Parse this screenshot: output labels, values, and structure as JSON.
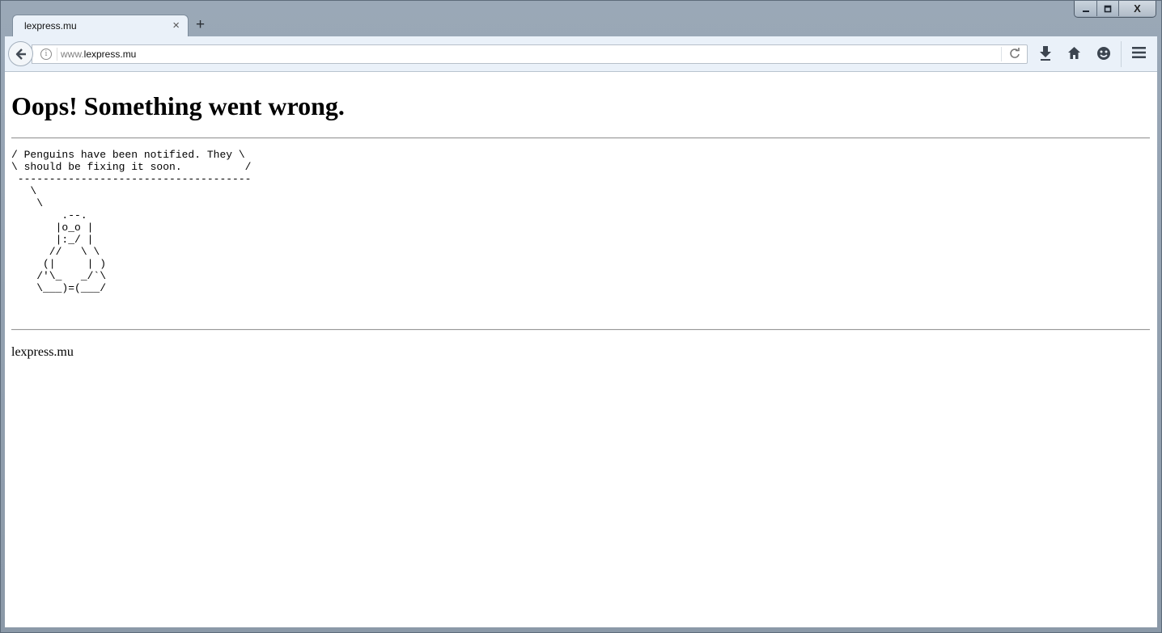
{
  "window": {
    "minimize_icon": "minimize-icon",
    "maximize_icon": "maximize-icon",
    "close_label": "X"
  },
  "tab": {
    "title": "lexpress.mu",
    "close_label": "×",
    "new_tab_label": "+"
  },
  "urlbar": {
    "url_prefix": "www.",
    "url_domain": "lexpress.mu"
  },
  "page": {
    "heading": "Oops! Something went wrong.",
    "ascii_art": "/ Penguins have been notified. They \\\n\\ should be fixing it soon.          /\n -------------------------------------\n   \\\n    \\\n        .--.\n       |o_o |\n       |:_/ |\n      //   \\ \\\n     (|     | )\n    /'\\_   _/`\\\n    \\___)=(___/",
    "footer": "lexpress.mu"
  },
  "colors": {
    "toolbar_bg": "#eaf1f9",
    "frame": "#8e9cab"
  }
}
